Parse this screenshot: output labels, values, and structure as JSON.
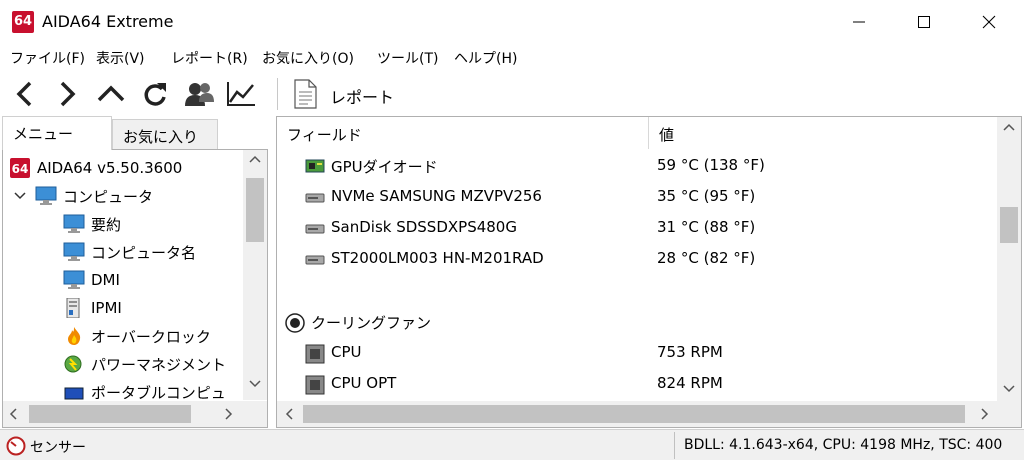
{
  "window": {
    "logo": "64",
    "title": "AIDA64 Extreme"
  },
  "menu": [
    "ファイル(F)",
    "表示(V)",
    "レポート(R)",
    "お気に入り(O)",
    "ツール(T)",
    "ヘルプ(H)"
  ],
  "toolbar": {
    "report_label": "レポート"
  },
  "left": {
    "tabs": [
      "メニュー",
      "お気に入り"
    ],
    "tree": [
      {
        "label": "AIDA64 v5.50.3600",
        "icon": "aida64-logo-icon",
        "level": 0
      },
      {
        "label": "コンピュータ",
        "icon": "computer-icon",
        "level": 1,
        "expanded": true
      },
      {
        "label": "要約",
        "icon": "monitor-icon",
        "level": 2
      },
      {
        "label": "コンピュータ名",
        "icon": "monitor-icon",
        "level": 2
      },
      {
        "label": "DMI",
        "icon": "monitor-icon",
        "level": 2
      },
      {
        "label": "IPMI",
        "icon": "server-icon",
        "level": 2
      },
      {
        "label": "オーバークロック",
        "icon": "fire-icon",
        "level": 2
      },
      {
        "label": "パワーマネジメント",
        "icon": "power-management-icon",
        "level": 2
      },
      {
        "label": "ポータブルコンピュ",
        "icon": "laptop-icon",
        "level": 2
      }
    ]
  },
  "right": {
    "columns": [
      "フィールド",
      "値"
    ],
    "rows": [
      {
        "name": "GPUダイオード",
        "value": "59 °C  (138 °F)",
        "icon": "gpu-card-icon",
        "type": "item"
      },
      {
        "name": "NVMe SAMSUNG MZVPV256",
        "value": "35 °C  (95 °F)",
        "icon": "drive-icon",
        "type": "item"
      },
      {
        "name": "SanDisk SDSSDXPS480G",
        "value": "31 °C  (88 °F)",
        "icon": "drive-icon",
        "type": "item"
      },
      {
        "name": "ST2000LM003 HN-M201RAD",
        "value": "28 °C  (82 °F)",
        "icon": "drive-icon",
        "type": "item"
      },
      {
        "name": "クーリングファン",
        "value": "",
        "icon": "fan-icon",
        "type": "group"
      },
      {
        "name": "CPU",
        "value": "753 RPM",
        "icon": "chip-icon",
        "type": "item"
      },
      {
        "name": "CPU OPT",
        "value": "824 RPM",
        "icon": "chip-icon",
        "type": "item"
      }
    ]
  },
  "status": {
    "left": "センサー",
    "right": "BDLL: 4.1.643-x64, CPU: 4198 MHz, TSC: 400"
  }
}
